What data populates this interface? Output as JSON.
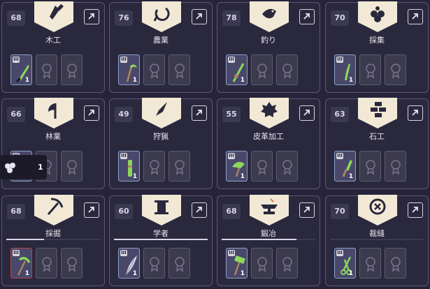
{
  "cards": [
    {
      "level": "68",
      "name": "木工",
      "icon": "chisel-icon",
      "tier": "III",
      "qty": "1",
      "tool": "blade"
    },
    {
      "level": "76",
      "name": "農業",
      "icon": "sickle-icon",
      "tier": "III",
      "qty": "1",
      "tool": "scythe"
    },
    {
      "level": "78",
      "name": "釣り",
      "icon": "fish-icon",
      "tier": "III",
      "qty": "1",
      "tool": "rod"
    },
    {
      "level": "70",
      "name": "採集",
      "icon": "berries-icon",
      "tier": "III",
      "qty": "1",
      "tool": "knife"
    },
    {
      "level": "66",
      "name": "林業",
      "icon": "axe-icon",
      "tier": "III",
      "qty": "1",
      "tool": "axe"
    },
    {
      "level": "49",
      "name": "狩猟",
      "icon": "arrowhead-icon",
      "tier": "III",
      "qty": "1",
      "tool": "bow"
    },
    {
      "level": "55",
      "name": "皮革加工",
      "icon": "leather-icon",
      "tier": "III",
      "qty": "1",
      "tool": "scraper"
    },
    {
      "level": "63",
      "name": "石工",
      "icon": "bricks-icon",
      "tier": "III",
      "qty": "1",
      "tool": "chisel"
    },
    {
      "level": "68",
      "name": "採掘",
      "icon": "pickaxe-icon",
      "tier": "III",
      "qty": "1",
      "tool": "pickaxe",
      "progress": 0.4
    },
    {
      "level": "60",
      "name": "学者",
      "icon": "scroll-icon",
      "tier": "III",
      "qty": "1",
      "tool": "quill",
      "progress": 1.0
    },
    {
      "level": "68",
      "name": "鍛冶",
      "icon": "anvil-icon",
      "tier": "III",
      "qty": "1",
      "tool": "hammer",
      "progress": 0.8
    },
    {
      "level": "70",
      "name": "裁縫",
      "icon": "button-icon",
      "tier": "III",
      "qty": "1",
      "tool": "scissors",
      "progress": 0.0
    }
  ],
  "tooltip": {
    "qty": "1",
    "icon": "berries-icon"
  },
  "colors": {
    "background": "#26233a",
    "card": "#2a283d",
    "border": "#5b5875",
    "banner": "#f1e9d6",
    "tool_green": "#8bd85a"
  }
}
